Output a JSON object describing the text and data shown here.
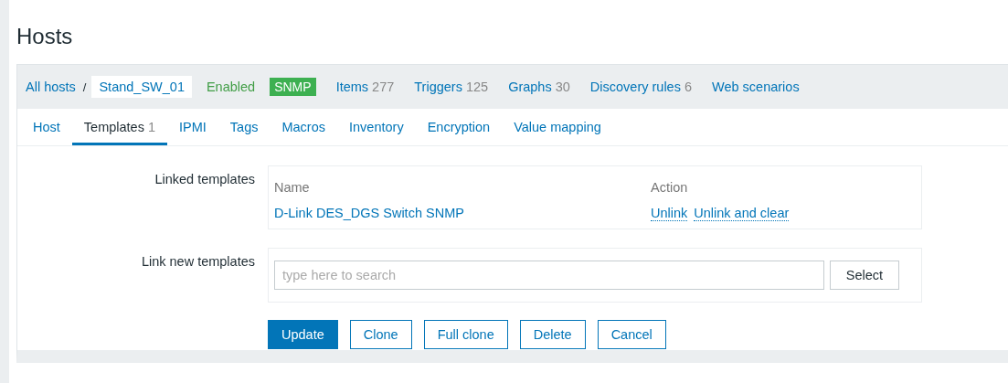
{
  "title": "Hosts",
  "breadcrumb": {
    "root": "All hosts",
    "separator": "/",
    "current": "Stand_SW_01",
    "status": "Enabled",
    "availability": [
      {
        "label": "SNMP",
        "color": "#3db051"
      }
    ],
    "links": [
      {
        "label": "Items",
        "count": "277"
      },
      {
        "label": "Triggers",
        "count": "125"
      },
      {
        "label": "Graphs",
        "count": "30"
      },
      {
        "label": "Discovery rules",
        "count": "6"
      },
      {
        "label": "Web scenarios"
      }
    ]
  },
  "tabs": [
    {
      "label": "Host",
      "selected": false
    },
    {
      "label": "Templates",
      "count": "1",
      "selected": true
    },
    {
      "label": "IPMI",
      "selected": false
    },
    {
      "label": "Tags",
      "selected": false
    },
    {
      "label": "Macros",
      "selected": false
    },
    {
      "label": "Inventory",
      "selected": false
    },
    {
      "label": "Encryption",
      "selected": false
    },
    {
      "label": "Value mapping",
      "selected": false
    }
  ],
  "linked_templates": {
    "label": "Linked templates",
    "columns": [
      "Name",
      "Action"
    ],
    "rows": [
      {
        "name": "D-Link DES_DGS Switch SNMP",
        "actions": [
          "Unlink",
          "Unlink and clear"
        ]
      }
    ]
  },
  "link_new": {
    "label": "Link new templates",
    "placeholder": "type here to search",
    "button": "Select"
  },
  "buttons": [
    {
      "label": "Update",
      "kind": "primary"
    },
    {
      "label": "Clone",
      "kind": "secondary"
    },
    {
      "label": "Full clone",
      "kind": "secondary"
    },
    {
      "label": "Delete",
      "kind": "secondary"
    },
    {
      "label": "Cancel",
      "kind": "secondary"
    }
  ]
}
